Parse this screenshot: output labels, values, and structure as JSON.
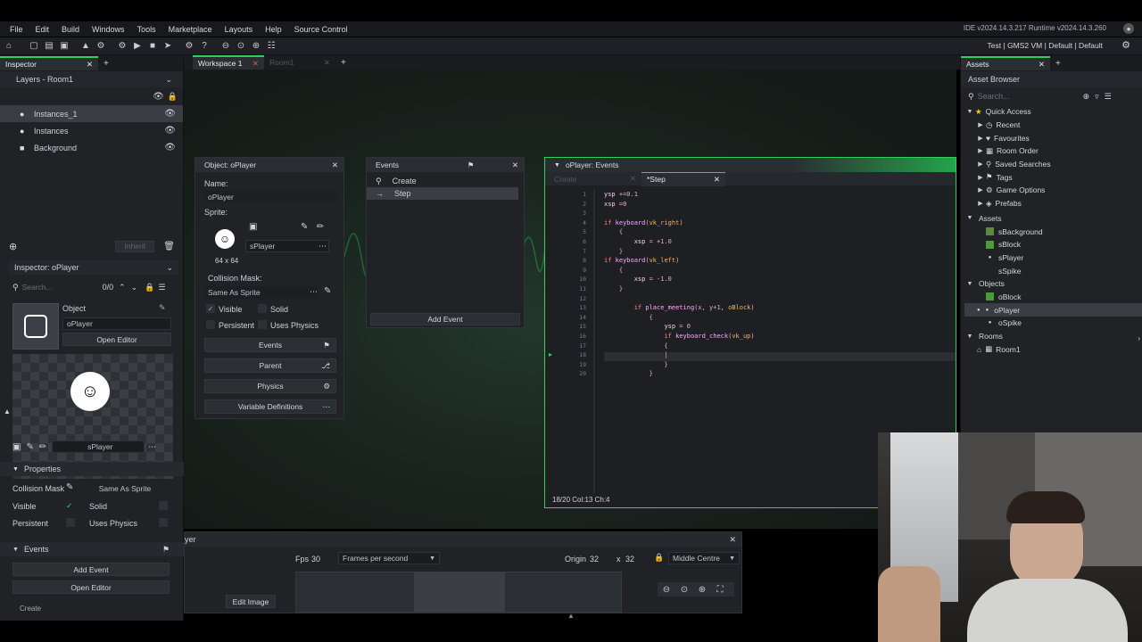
{
  "menu": [
    "File",
    "Edit",
    "Build",
    "Windows",
    "Tools",
    "Marketplace",
    "Layouts",
    "Help",
    "Source Control"
  ],
  "version": "IDE v2024.14.3.217  Runtime v2024.14.3.260",
  "targets": "Test | GMS2 VM | Default | Default",
  "left": {
    "inspector_tab": "Inspector",
    "layers_title": "Layers - Room1",
    "layers": [
      "Instances_1",
      "Instances",
      "Background"
    ],
    "inherit": "Inherit",
    "inspector_title": "Inspector: oPlayer",
    "search_placeholder": "Search...",
    "counter": "0/0",
    "object_label": "Object",
    "object_name": "oPlayer",
    "open_editor": "Open Editor",
    "sprite_name": "sPlayer",
    "properties": "Properties",
    "collision_mask_label": "Collision Mask",
    "collision_mask_value": "Same As Sprite",
    "visible": "Visible",
    "solid": "Solid",
    "persistent": "Persistent",
    "uses_physics": "Uses Physics",
    "events": "Events",
    "add_event": "Add Event",
    "open_editor2": "Open Editor",
    "create_cut": "Create"
  },
  "workspace": {
    "tabs": [
      "Workspace 1",
      "Room1"
    ],
    "object_window": {
      "title": "Object: oPlayer",
      "name_label": "Name:",
      "name_value": "oPlayer",
      "sprite_label": "Sprite:",
      "sprite_size": "64 x 64",
      "sprite_value": "sPlayer",
      "collision_label": "Collision Mask:",
      "collision_value": "Same As Sprite",
      "visible": "Visible",
      "solid": "Solid",
      "persistent": "Persistent",
      "uses_physics": "Uses Physics",
      "buttons": [
        "Events",
        "Parent",
        "Physics",
        "Variable Definitions"
      ]
    },
    "events_window": {
      "title": "Events",
      "items": [
        "Create",
        "Step"
      ],
      "add_event": "Add Event"
    },
    "code_window": {
      "title": "oPlayer: Events",
      "tabs": [
        "Create",
        "*Step"
      ],
      "lines": [
        "ysp +=0.1",
        "xsp =0",
        "",
        "if keyboard(vk_right)",
        "    {",
        "        xsp = +1.0",
        "    }",
        "if keyboard(vk_left)",
        "    {",
        "        xsp = -1.0",
        "    }",
        "",
        "        if place_meeting(x, y+1, oBlock)",
        "            {",
        "                ysp = 0",
        "                if keyboard_check(vk_up)",
        "                {",
        "                |",
        "                }",
        "            }"
      ],
      "status": "18/20 Col:13 Ch:4"
    },
    "sprite_strip": {
      "title": "yer",
      "fps_label": "Fps",
      "fps_value": "30",
      "fps_mode": "Frames per second",
      "origin_label": "Origin",
      "origin_x": "32",
      "origin_x_sep": "x",
      "origin_y": "32",
      "origin_mode": "Middle Centre",
      "edit_image": "Edit Image"
    }
  },
  "assets": {
    "tab": "Assets",
    "title": "Asset Browser",
    "search_placeholder": "Search...",
    "quick_access": "Quick Access",
    "quick_items": [
      "Recent",
      "Favourites",
      "Room Order",
      "Saved Searches",
      "Tags",
      "Game Options",
      "Prefabs"
    ],
    "assets_label": "Assets",
    "sprites": [
      "sBackground",
      "sBlock",
      "sPlayer",
      "sSpike"
    ],
    "objects_label": "Objects",
    "objects": [
      "oBlock",
      "oPlayer",
      "oSpike"
    ],
    "rooms_label": "Rooms",
    "rooms": [
      "Room1"
    ]
  },
  "colors": {
    "accent": "#30d158",
    "panel": "#202226",
    "code_bg": "#1d1f23"
  }
}
